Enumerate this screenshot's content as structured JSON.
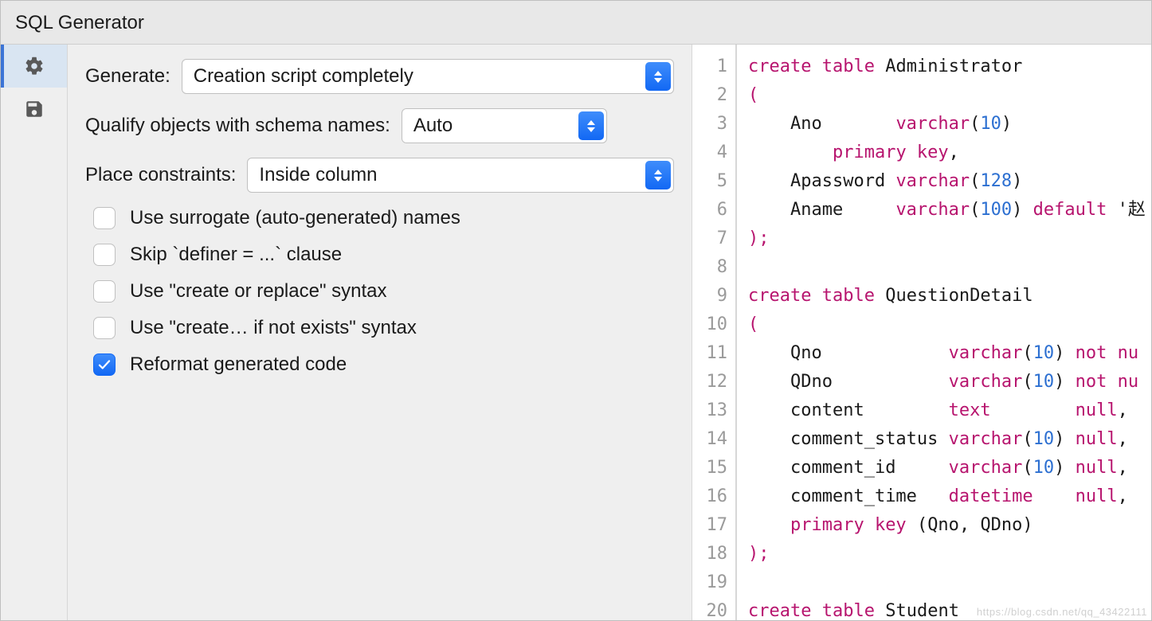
{
  "title": "SQL Generator",
  "options": {
    "generate_label": "Generate:",
    "generate_value": "Creation script completely",
    "qualify_label": "Qualify objects with schema names:",
    "qualify_value": "Auto",
    "constraints_label": "Place constraints:",
    "constraints_value": "Inside column",
    "checks": [
      {
        "label": "Use surrogate (auto-generated) names",
        "checked": false
      },
      {
        "label": "Skip `definer = ...` clause",
        "checked": false
      },
      {
        "label": "Use \"create or replace\" syntax",
        "checked": false
      },
      {
        "label": "Use \"create… if not exists\" syntax",
        "checked": false
      },
      {
        "label": "Reformat generated code",
        "checked": true
      }
    ]
  },
  "code": {
    "first_line": 1,
    "lines": [
      [
        {
          "k": "kw",
          "t": "create"
        },
        {
          "k": "sp",
          "t": " "
        },
        {
          "k": "kw",
          "t": "table"
        },
        {
          "k": "sp",
          "t": " "
        },
        {
          "k": "id",
          "t": "Administrator"
        }
      ],
      [
        {
          "k": "paren",
          "t": "("
        }
      ],
      [
        {
          "k": "sp",
          "t": "    "
        },
        {
          "k": "id",
          "t": "Ano       "
        },
        {
          "k": "type",
          "t": "varchar"
        },
        {
          "k": "punct",
          "t": "("
        },
        {
          "k": "num",
          "t": "10"
        },
        {
          "k": "punct",
          "t": ")"
        }
      ],
      [
        {
          "k": "sp",
          "t": "        "
        },
        {
          "k": "mod",
          "t": "primary key"
        },
        {
          "k": "punct",
          "t": ","
        }
      ],
      [
        {
          "k": "sp",
          "t": "    "
        },
        {
          "k": "id",
          "t": "Apassword "
        },
        {
          "k": "type",
          "t": "varchar"
        },
        {
          "k": "punct",
          "t": "("
        },
        {
          "k": "num",
          "t": "128"
        },
        {
          "k": "punct",
          "t": ")"
        }
      ],
      [
        {
          "k": "sp",
          "t": "    "
        },
        {
          "k": "id",
          "t": "Aname     "
        },
        {
          "k": "type",
          "t": "varchar"
        },
        {
          "k": "punct",
          "t": "("
        },
        {
          "k": "num",
          "t": "100"
        },
        {
          "k": "punct",
          "t": ") "
        },
        {
          "k": "kw",
          "t": "default"
        },
        {
          "k": "sp",
          "t": " '赵"
        }
      ],
      [
        {
          "k": "paren",
          "t": ");"
        }
      ],
      [],
      [
        {
          "k": "kw",
          "t": "create"
        },
        {
          "k": "sp",
          "t": " "
        },
        {
          "k": "kw",
          "t": "table"
        },
        {
          "k": "sp",
          "t": " "
        },
        {
          "k": "id",
          "t": "QuestionDetail"
        }
      ],
      [
        {
          "k": "paren",
          "t": "("
        }
      ],
      [
        {
          "k": "sp",
          "t": "    "
        },
        {
          "k": "id",
          "t": "Qno            "
        },
        {
          "k": "type",
          "t": "varchar"
        },
        {
          "k": "punct",
          "t": "("
        },
        {
          "k": "num",
          "t": "10"
        },
        {
          "k": "punct",
          "t": ") "
        },
        {
          "k": "mod",
          "t": "not nu"
        }
      ],
      [
        {
          "k": "sp",
          "t": "    "
        },
        {
          "k": "id",
          "t": "QDno           "
        },
        {
          "k": "type",
          "t": "varchar"
        },
        {
          "k": "punct",
          "t": "("
        },
        {
          "k": "num",
          "t": "10"
        },
        {
          "k": "punct",
          "t": ") "
        },
        {
          "k": "mod",
          "t": "not nu"
        }
      ],
      [
        {
          "k": "sp",
          "t": "    "
        },
        {
          "k": "id",
          "t": "content        "
        },
        {
          "k": "type",
          "t": "text        "
        },
        {
          "k": "mod",
          "t": "null"
        },
        {
          "k": "punct",
          "t": ","
        }
      ],
      [
        {
          "k": "sp",
          "t": "    "
        },
        {
          "k": "id",
          "t": "comment_status "
        },
        {
          "k": "type",
          "t": "varchar"
        },
        {
          "k": "punct",
          "t": "("
        },
        {
          "k": "num",
          "t": "10"
        },
        {
          "k": "punct",
          "t": ") "
        },
        {
          "k": "mod",
          "t": "null"
        },
        {
          "k": "punct",
          "t": ","
        }
      ],
      [
        {
          "k": "sp",
          "t": "    "
        },
        {
          "k": "id",
          "t": "comment_id     "
        },
        {
          "k": "type",
          "t": "varchar"
        },
        {
          "k": "punct",
          "t": "("
        },
        {
          "k": "num",
          "t": "10"
        },
        {
          "k": "punct",
          "t": ") "
        },
        {
          "k": "mod",
          "t": "null"
        },
        {
          "k": "punct",
          "t": ","
        }
      ],
      [
        {
          "k": "sp",
          "t": "    "
        },
        {
          "k": "id",
          "t": "comment_time   "
        },
        {
          "k": "type",
          "t": "datetime    "
        },
        {
          "k": "mod",
          "t": "null"
        },
        {
          "k": "punct",
          "t": ","
        }
      ],
      [
        {
          "k": "sp",
          "t": "    "
        },
        {
          "k": "mod",
          "t": "primary key"
        },
        {
          "k": "sp",
          "t": " "
        },
        {
          "k": "punct",
          "t": "("
        },
        {
          "k": "id",
          "t": "Qno"
        },
        {
          "k": "punct",
          "t": ", "
        },
        {
          "k": "id",
          "t": "QDno"
        },
        {
          "k": "punct",
          "t": ")"
        }
      ],
      [
        {
          "k": "paren",
          "t": ");"
        }
      ],
      [],
      [
        {
          "k": "kw",
          "t": "create"
        },
        {
          "k": "sp",
          "t": " "
        },
        {
          "k": "kw",
          "t": "table"
        },
        {
          "k": "sp",
          "t": " "
        },
        {
          "k": "id",
          "t": "Student"
        }
      ]
    ]
  },
  "watermark": "https://blog.csdn.net/qq_43422111"
}
